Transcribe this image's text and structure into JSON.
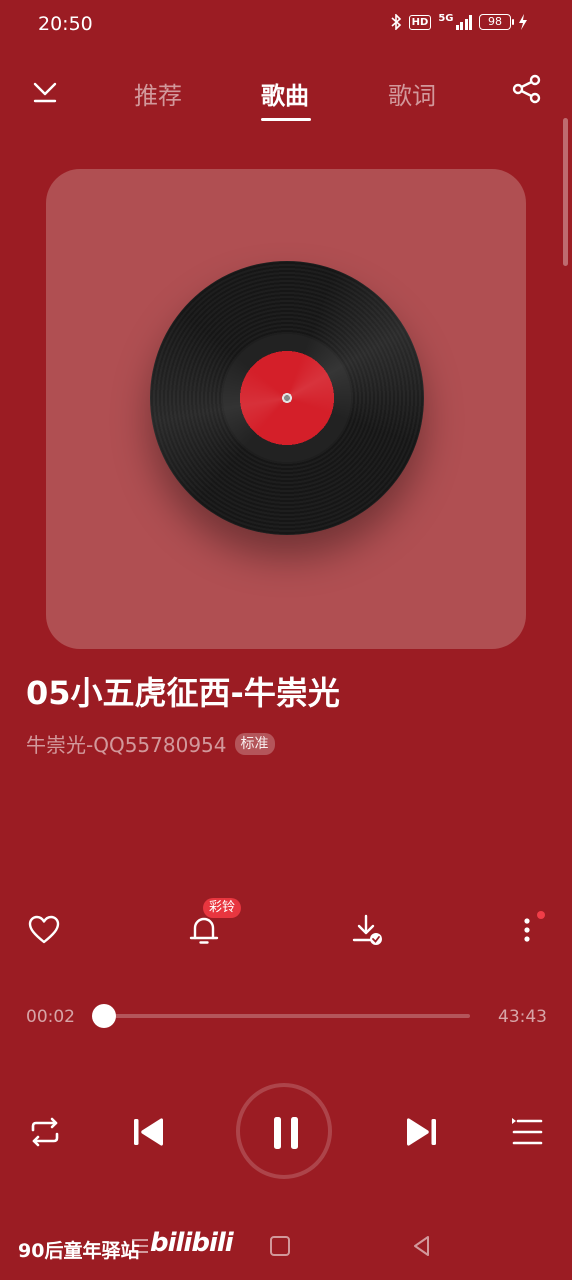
{
  "status_bar": {
    "time": "20:50",
    "network": "5G",
    "hd_label": "HD",
    "battery": "98",
    "icons": [
      "bluetooth-icon",
      "hd-icon",
      "signal-icon",
      "battery-icon",
      "charging-icon"
    ]
  },
  "nav": {
    "tabs": [
      {
        "label": "推荐"
      },
      {
        "label": "歌曲"
      },
      {
        "label": "歌词"
      }
    ],
    "active_tab": "歌曲"
  },
  "song": {
    "title": "05小五虎征西-牛崇光",
    "artist": "牛崇光-QQ55780954",
    "quality": "标准"
  },
  "actions": {
    "ringtone_badge": "彩铃"
  },
  "player": {
    "current_time": "00:02",
    "total_time": "43:43",
    "progress": 0.001,
    "state": "playing"
  },
  "watermark": {
    "text": "90后童年驿站",
    "logo": "bilibili"
  },
  "colors": {
    "background": "#9b1c23",
    "card": "#b04f52",
    "record_label": "#d41f29",
    "badge": "#e8363f"
  }
}
